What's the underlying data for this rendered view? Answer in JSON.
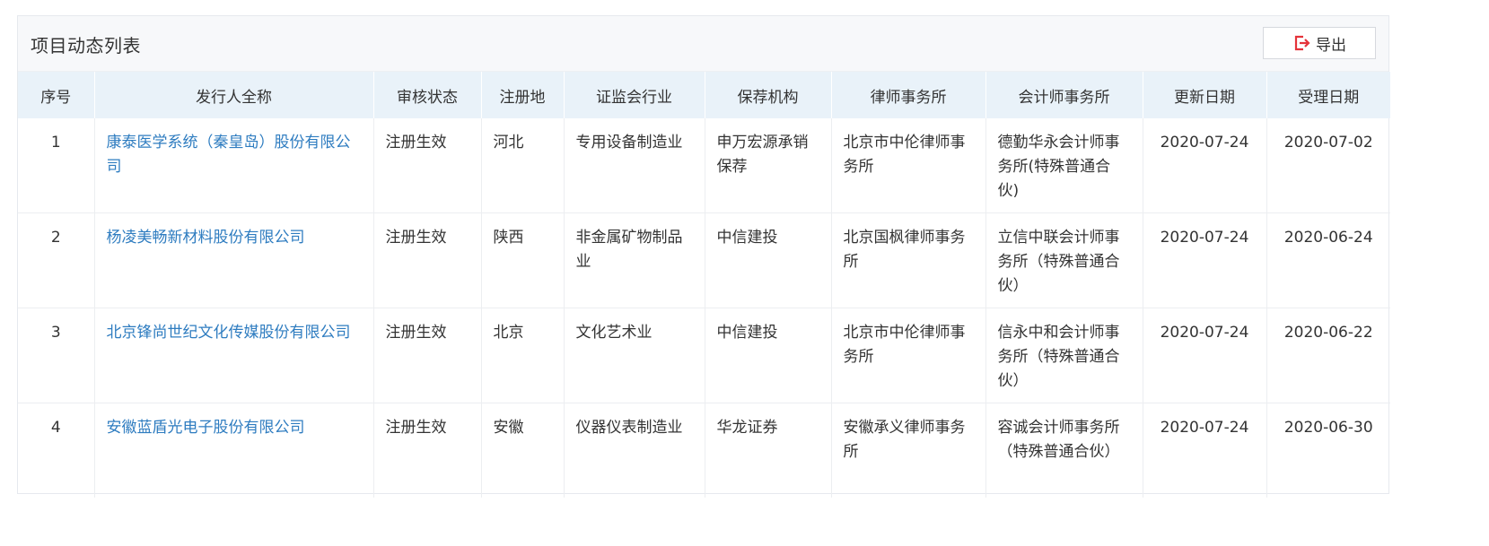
{
  "panel": {
    "title": "项目动态列表",
    "export_label": "导出",
    "export_icon": "export-icon"
  },
  "columns": [
    "序号",
    "发行人全称",
    "审核状态",
    "注册地",
    "证监会行业",
    "保荐机构",
    "律师事务所",
    "会计师事务所",
    "更新日期",
    "受理日期"
  ],
  "rows": [
    {
      "index": "1",
      "issuer": "康泰医学系统（秦皇岛）股份有限公司",
      "status": "注册生效",
      "region": "河北",
      "industry": "专用设备制造业",
      "sponsor": "申万宏源承销保荐",
      "law_firm": "北京市中伦律师事务所",
      "accounting_firm": "德勤华永会计师事务所(特殊普通合伙)",
      "updated": "2020-07-24",
      "accepted": "2020-07-02"
    },
    {
      "index": "2",
      "issuer": "杨凌美畅新材料股份有限公司",
      "status": "注册生效",
      "region": "陕西",
      "industry": "非金属矿物制品业",
      "sponsor": "中信建投",
      "law_firm": "北京国枫律师事务所",
      "accounting_firm": "立信中联会计师事务所（特殊普通合伙）",
      "updated": "2020-07-24",
      "accepted": "2020-06-24"
    },
    {
      "index": "3",
      "issuer": "北京锋尚世纪文化传媒股份有限公司",
      "status": "注册生效",
      "region": "北京",
      "industry": "文化艺术业",
      "sponsor": "中信建投",
      "law_firm": "北京市中伦律师事务所",
      "accounting_firm": "信永中和会计师事务所（特殊普通合伙）",
      "updated": "2020-07-24",
      "accepted": "2020-06-22"
    },
    {
      "index": "4",
      "issuer": "安徽蓝盾光电子股份有限公司",
      "status": "注册生效",
      "region": "安徽",
      "industry": "仪器仪表制造业",
      "sponsor": "华龙证券",
      "law_firm": "安徽承义律师事务所",
      "accounting_firm": "容诚会计师事务所（特殊普通合伙）",
      "updated": "2020-07-24",
      "accepted": "2020-06-30"
    }
  ],
  "colors": {
    "link": "#2e7cc0",
    "header_bg": "#e9f2f9",
    "export_icon": "#e5333a"
  }
}
